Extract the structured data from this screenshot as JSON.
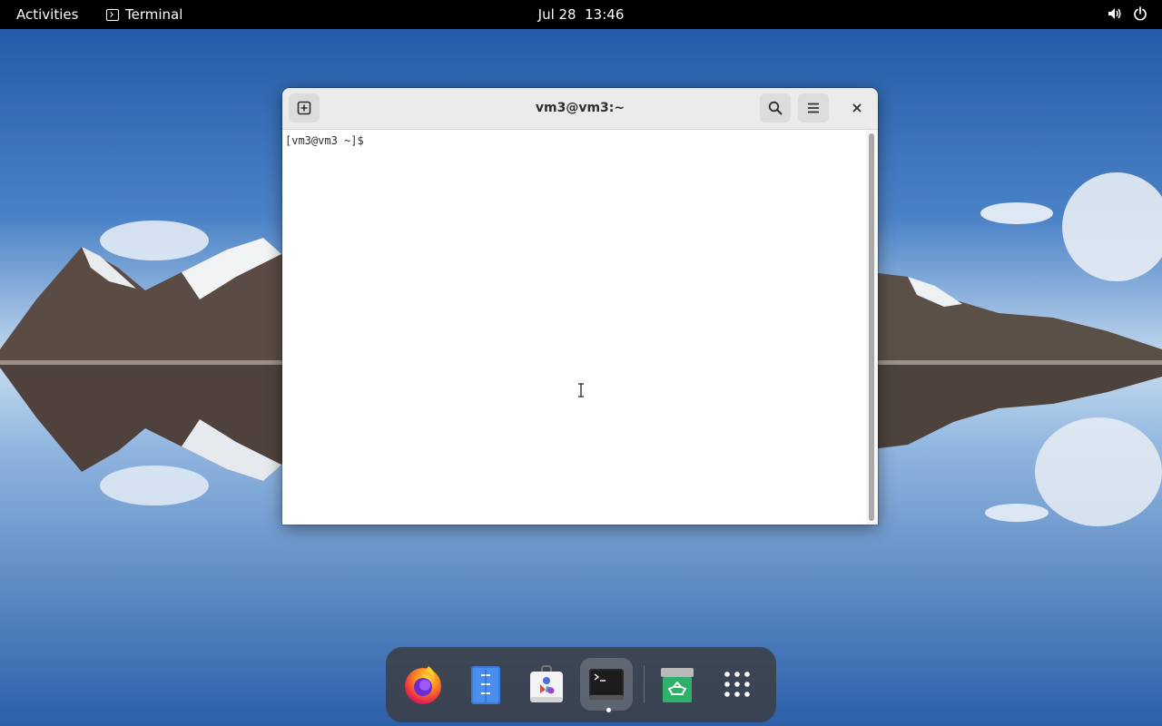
{
  "topbar": {
    "activities": "Activities",
    "app_name": "Terminal",
    "clock": "Jul 28  13:46",
    "status_icons": [
      "volume-icon",
      "power-icon"
    ]
  },
  "window": {
    "title": "vm3@vm3:~",
    "buttons": [
      "new-tab-icon",
      "search-icon",
      "menu-icon",
      "close-icon"
    ],
    "prompt": "[vm3@vm3 ~]$ "
  },
  "dock": {
    "apps": [
      "firefox-icon",
      "text-editor-icon",
      "software-icon",
      "terminal-icon",
      "trash-icon",
      "app-grid-icon"
    ],
    "active_app": "terminal-icon"
  },
  "colors": {
    "topbar": "#000000",
    "headerbar": "#ebebeb",
    "dock": "#3c3c3e",
    "terminal_bg": "#ffffff"
  }
}
